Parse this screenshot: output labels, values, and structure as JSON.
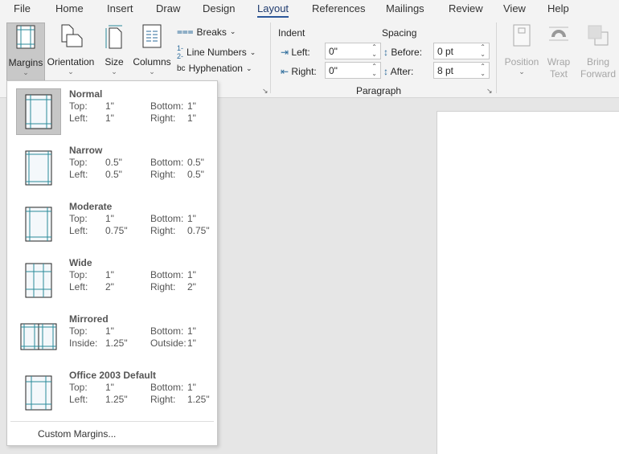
{
  "tabs": [
    "File",
    "Home",
    "Insert",
    "Draw",
    "Design",
    "Layout",
    "References",
    "Mailings",
    "Review",
    "View",
    "Help"
  ],
  "active_tab": "Layout",
  "page_setup": {
    "margins": "Margins",
    "orientation": "Orientation",
    "size": "Size",
    "columns": "Columns",
    "breaks": "Breaks",
    "line_numbers": "Line Numbers",
    "hyphenation": "Hyphenation"
  },
  "paragraph": {
    "group_label": "Paragraph",
    "indent_label": "Indent",
    "spacing_label": "Spacing",
    "left_label": "Left:",
    "right_label": "Right:",
    "before_label": "Before:",
    "after_label": "After:",
    "left_value": "0\"",
    "right_value": "0\"",
    "before_value": "0 pt",
    "after_value": "8 pt"
  },
  "arrange": {
    "position": "Position",
    "wrap_text_1": "Wrap",
    "wrap_text_2": "Text",
    "bring_forward_1": "Bring",
    "bring_forward_2": "Forward"
  },
  "margins_menu": {
    "items": [
      {
        "name": "Normal",
        "l1": "Top:",
        "v1": "1\"",
        "l2": "Bottom:",
        "v2": "1\"",
        "l3": "Left:",
        "v3": "1\"",
        "l4": "Right:",
        "v4": "1\"",
        "inset": 1
      },
      {
        "name": "Narrow",
        "l1": "Top:",
        "v1": "0.5\"",
        "l2": "Bottom:",
        "v2": "0.5\"",
        "l3": "Left:",
        "v3": "0.5\"",
        "l4": "Right:",
        "v4": "0.5\"",
        "inset": 0.5
      },
      {
        "name": "Moderate",
        "l1": "Top:",
        "v1": "1\"",
        "l2": "Bottom:",
        "v2": "1\"",
        "l3": "Left:",
        "v3": "0.75\"",
        "l4": "Right:",
        "v4": "0.75\"",
        "inset": 0.75
      },
      {
        "name": "Wide",
        "l1": "Top:",
        "v1": "1\"",
        "l2": "Bottom:",
        "v2": "1\"",
        "l3": "Left:",
        "v3": "2\"",
        "l4": "Right:",
        "v4": "2\"",
        "inset": 2
      },
      {
        "name": "Mirrored",
        "l1": "Top:",
        "v1": "1\"",
        "l2": "Bottom:",
        "v2": "1\"",
        "l3": "Inside:",
        "v3": "1.25\"",
        "l4": "Outside:",
        "v4": "1\"",
        "inset": 1
      },
      {
        "name": "Office 2003 Default",
        "l1": "Top:",
        "v1": "1\"",
        "l2": "Bottom:",
        "v2": "1\"",
        "l3": "Left:",
        "v3": "1.25\"",
        "l4": "Right:",
        "v4": "1.25\"",
        "inset": 1.25
      }
    ],
    "custom": "Custom Margins..."
  }
}
